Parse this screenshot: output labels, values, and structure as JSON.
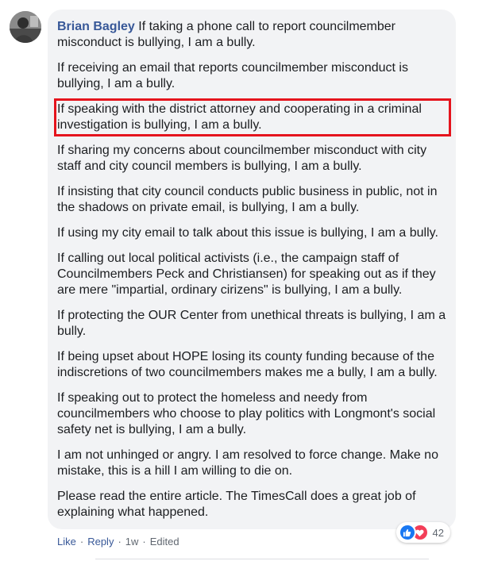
{
  "comment": {
    "author": "Brian Bagley",
    "first_paragraph_text": "If taking a phone call to report councilmember misconduct is bullying, I am a bully.",
    "paragraphs": [
      "If receiving an email that reports councilmember misconduct is bullying, I am a bully.",
      "If speaking with the district attorney and cooperating in a criminal investigation is bullying, I am a bully.",
      "If sharing my concerns about councilmember misconduct with city staff and city council members is bullying, I am a bully.",
      "If insisting that city council conducts public business in public, not in the shadows on private email, is bullying, I am a bully.",
      "If using my city email to talk about this issue is bullying, I am a bully.",
      "If calling out local political activists (i.e., the campaign staff of Councilmembers Peck and Christiansen) for speaking out as if they are mere \"impartial, ordinary cirizens\" is bullying, I am a bully.",
      "If protecting the OUR Center from unethical threats is bullying, I am a bully.",
      "If being upset about HOPE losing its county funding because of the indiscretions of two councilmembers makes me a bully, I am a bully.",
      "If speaking out to protect the homeless and needy from councilmembers who choose to play politics with Longmont's social safety net is bullying, I am a bully.",
      "I am not unhinged or angry. I am resolved to force change. Make no mistake, this is a hill I am willing to die on.",
      "Please read the entire article. The TimesCall does a great job of explaining what happened."
    ],
    "highlighted_paragraph_index": 1,
    "highlight_color": "#e5141d"
  },
  "reactions": {
    "icons": [
      "like-icon",
      "love-icon"
    ],
    "count": "42",
    "like_color": "#1877f2",
    "love_color": "#f33e58"
  },
  "actions": {
    "like_label": "Like",
    "reply_label": "Reply",
    "separator": "·",
    "time": "1w",
    "edited_label": "Edited"
  },
  "colors": {
    "author_link": "#385898",
    "bubble_background": "#f2f3f5",
    "text": "#1c1e21",
    "meta_text": "#606770"
  }
}
